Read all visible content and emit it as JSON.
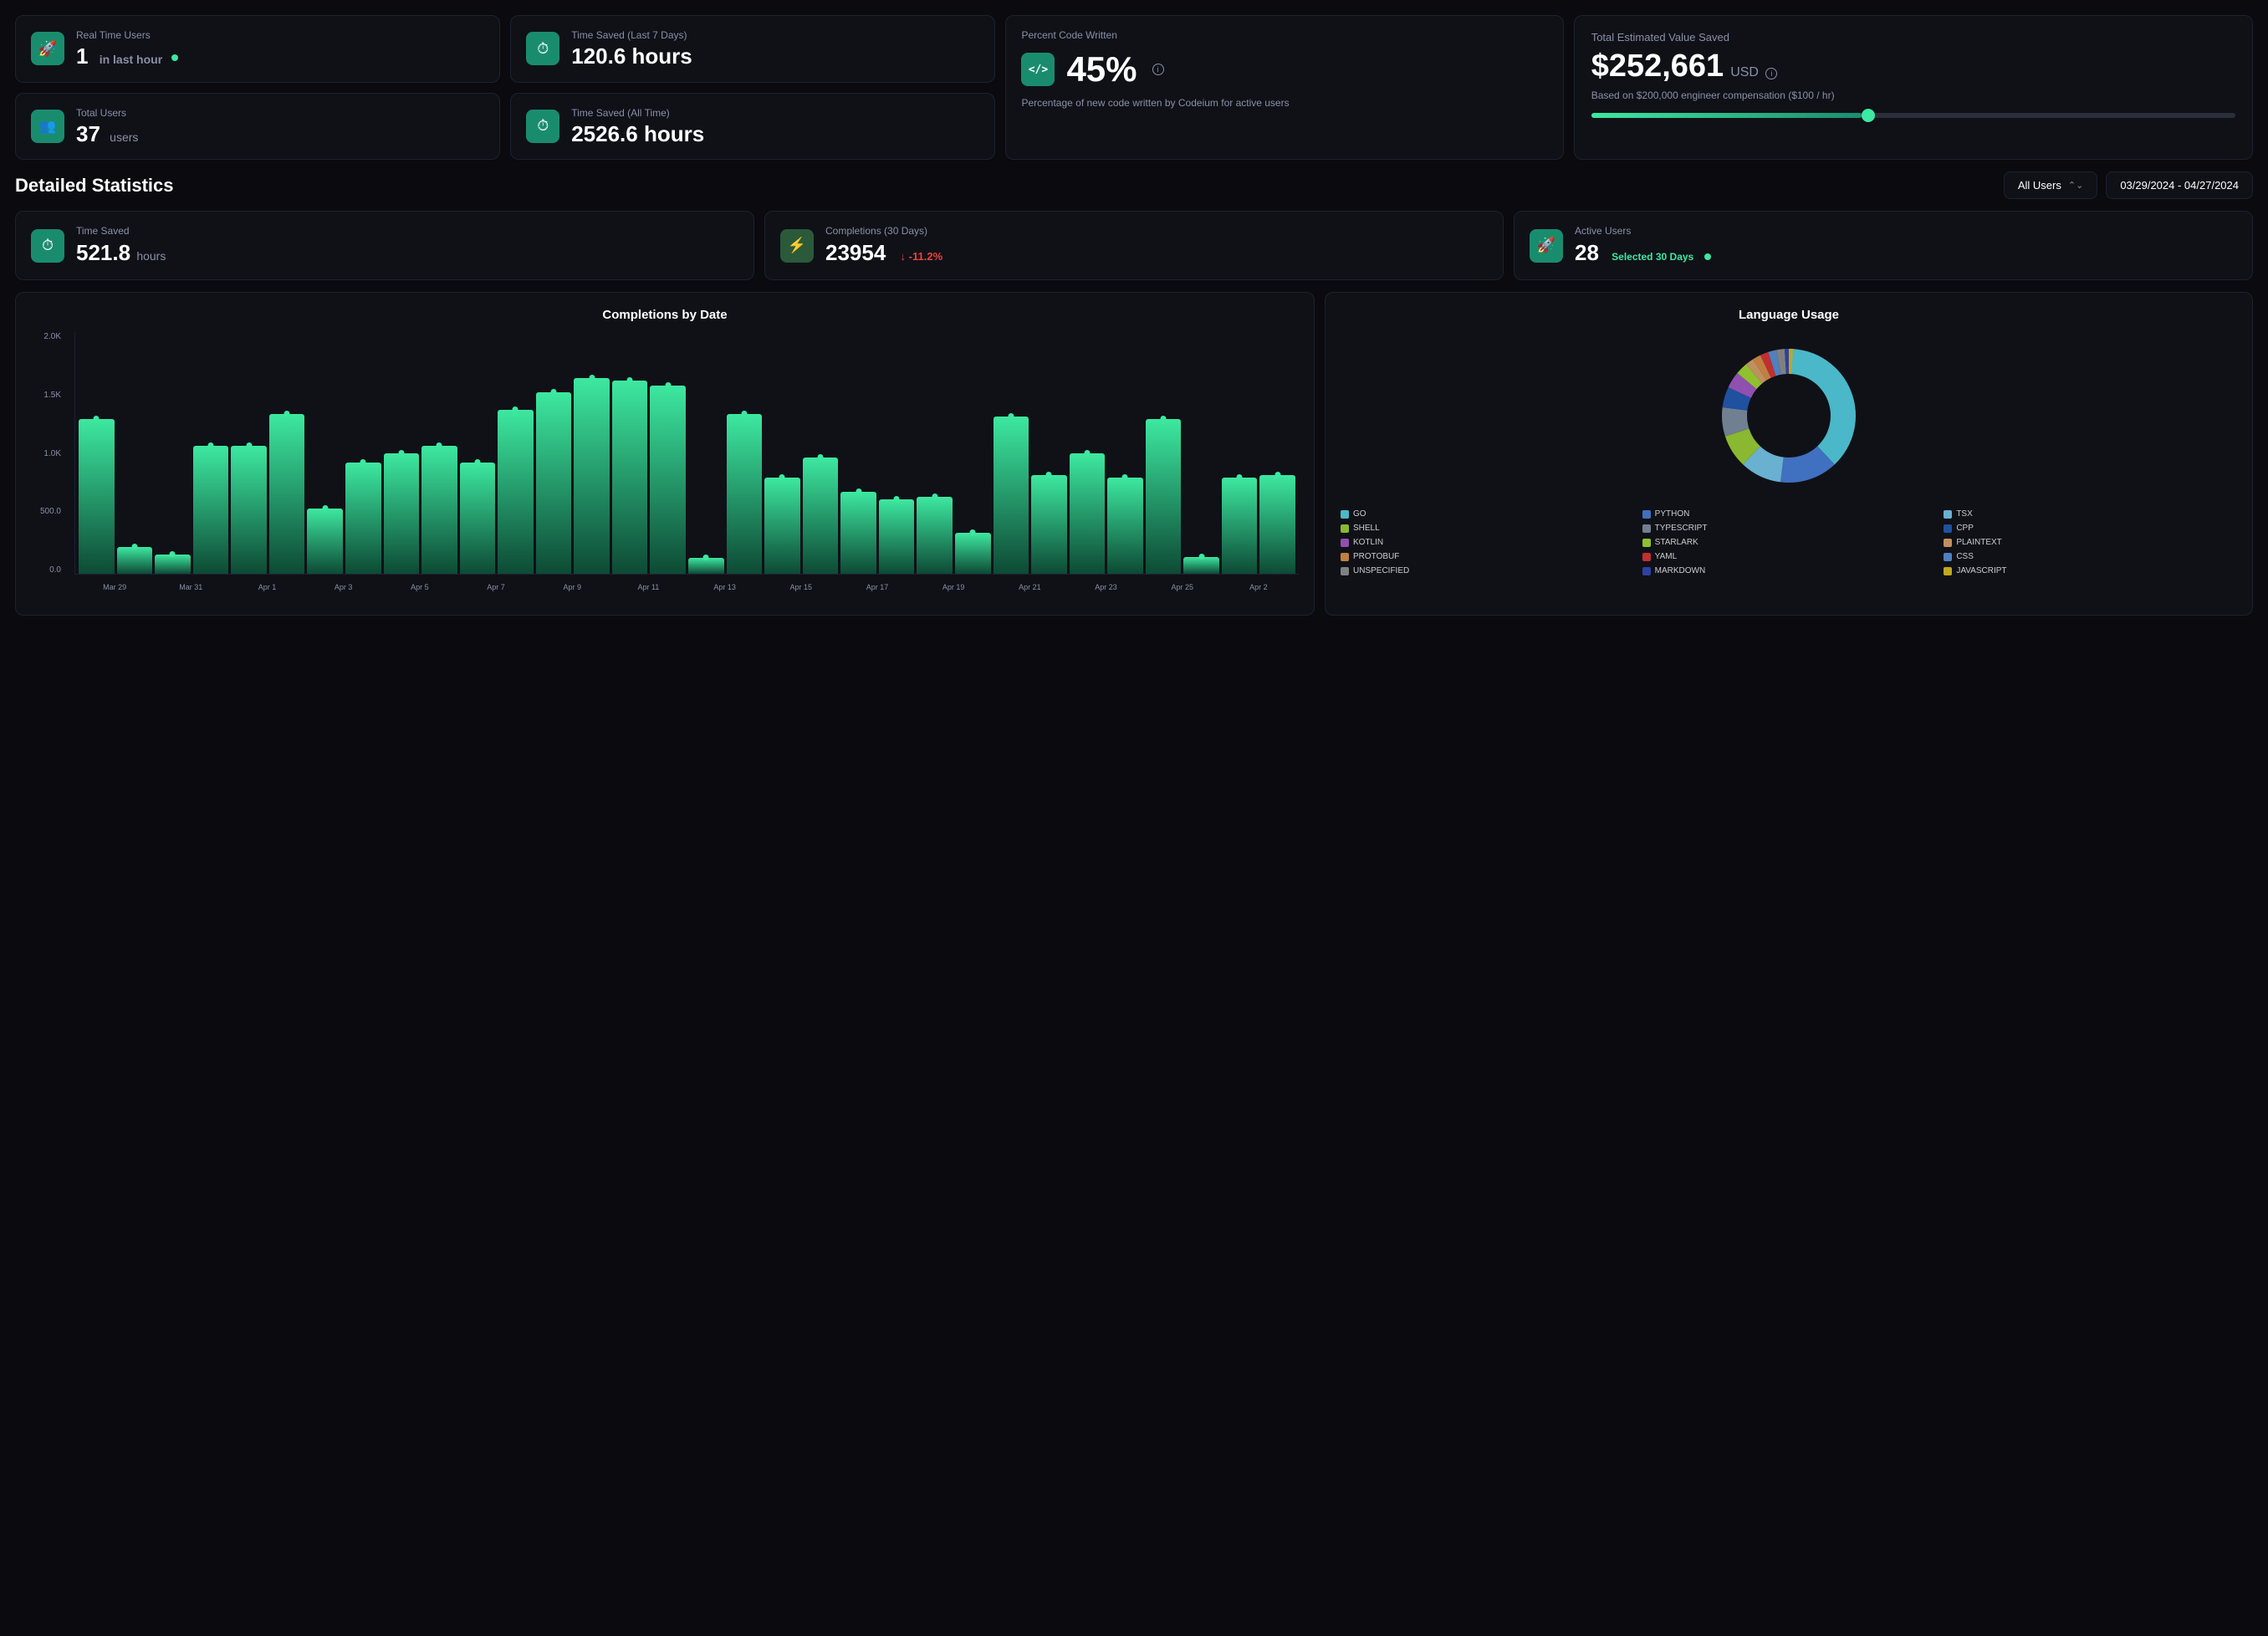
{
  "header_cards": {
    "realtime": {
      "label": "Real Time Users",
      "value": "1",
      "sub": "in last hour",
      "icon": "rocket"
    },
    "time_saved_7": {
      "label": "Time Saved (Last 7 Days)",
      "value": "120.6 hours",
      "icon": "clock"
    },
    "total_users": {
      "label": "Total Users",
      "value": "37",
      "unit": "users",
      "icon": "users"
    },
    "time_saved_all": {
      "label": "Time Saved (All Time)",
      "value": "2526.6 hours",
      "icon": "clock"
    },
    "percent_code": {
      "label": "Percent Code Written",
      "value": "45%",
      "sub": "Percentage of new code written by Codeium for active users"
    },
    "total_value": {
      "label": "Total Estimated Value Saved",
      "value": "$252,661",
      "usd": "USD",
      "sub": "Based on $200,000 engineer compensation ($100 / hr)",
      "slider_percent": 42
    }
  },
  "section": {
    "title": "Detailed Statistics",
    "filter_label": "All Users",
    "date_range": "03/29/2024 - 04/27/2024"
  },
  "stat_cards": {
    "time_saved": {
      "label": "Time Saved",
      "value": "521.8",
      "unit": "hours",
      "icon": "clock"
    },
    "completions": {
      "label": "Completions (30 Days)",
      "value": "23954",
      "change": "-11.2%",
      "icon": "bolt"
    },
    "active_users": {
      "label": "Active Users",
      "value": "28",
      "selected": "Selected 30 Days",
      "icon": "rocket"
    }
  },
  "bar_chart": {
    "title": "Completions by Date",
    "y_labels": [
      "2.0K",
      "1.5K",
      "1.0K",
      "500.0",
      "0.0"
    ],
    "x_labels": [
      "Mar 29",
      "Mar 31",
      "Apr 1",
      "Apr 3",
      "Apr 5",
      "Apr 7",
      "Apr 9",
      "Apr 11",
      "Apr 13",
      "Apr 15",
      "Apr 17",
      "Apr 19",
      "Apr 21",
      "Apr 23",
      "Apr 25",
      "Apr 2"
    ],
    "bars": [
      1280,
      220,
      160,
      1060,
      1060,
      1320,
      540,
      920,
      1000,
      1060,
      920,
      1360,
      1500,
      1620,
      1600,
      1560,
      130,
      1320,
      800,
      960,
      680,
      620,
      640,
      340,
      1300,
      820,
      1000,
      800,
      1280,
      140,
      800,
      820
    ]
  },
  "donut_chart": {
    "title": "Language Usage",
    "segments": [
      {
        "label": "GO",
        "color": "#4ab8c8",
        "percent": 38
      },
      {
        "label": "PYTHON",
        "color": "#4070c0",
        "percent": 14
      },
      {
        "label": "TSX",
        "color": "#6ab0d0",
        "percent": 10
      },
      {
        "label": "SHELL",
        "color": "#8ab830",
        "percent": 8
      },
      {
        "label": "TYPESCRIPT",
        "color": "#708090",
        "percent": 7
      },
      {
        "label": "CPP",
        "color": "#2050a0",
        "percent": 5
      },
      {
        "label": "KOTLIN",
        "color": "#9050b0",
        "percent": 4
      },
      {
        "label": "STARLARK",
        "color": "#90c030",
        "percent": 3
      },
      {
        "label": "PLAINTEXT",
        "color": "#c09060",
        "percent": 2
      },
      {
        "label": "PROTOBUF",
        "color": "#c08040",
        "percent": 2
      },
      {
        "label": "YAML",
        "color": "#c03030",
        "percent": 2
      },
      {
        "label": "CSS",
        "color": "#5080c0",
        "percent": 2
      },
      {
        "label": "UNSPECIFIED",
        "color": "#808080",
        "percent": 2
      },
      {
        "label": "MARKDOWN",
        "color": "#3040a0",
        "percent": 1
      },
      {
        "label": "JAVASCRIPT",
        "color": "#c0a820",
        "percent": 1
      }
    ]
  }
}
